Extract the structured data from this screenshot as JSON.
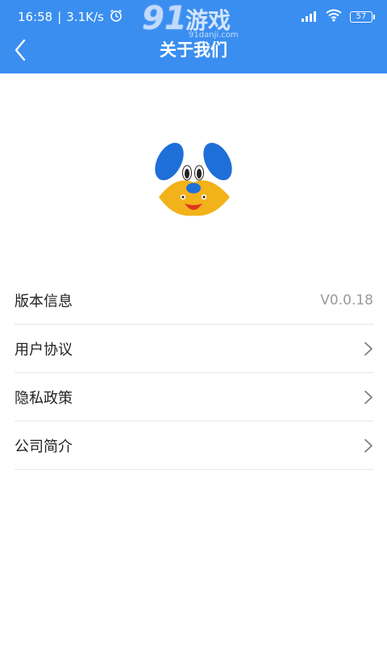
{
  "status_bar": {
    "time": "16:58",
    "speed": "3.1K/s",
    "battery": "57",
    "icons": [
      "alarm-icon",
      "signal-icon",
      "wifi-icon",
      "battery-icon"
    ]
  },
  "watermark": {
    "number": "91",
    "text": "游戏",
    "url": "91danji.com"
  },
  "header": {
    "title": "关于我们",
    "back_icon": "chevron-left-icon"
  },
  "menu": [
    {
      "label": "版本信息",
      "value": "V0.0.18"
    },
    {
      "label": "用户协议",
      "icon": "chevron-right-icon"
    },
    {
      "label": "隐私政策",
      "icon": "chevron-right-icon"
    },
    {
      "label": "公司简介",
      "icon": "chevron-right-icon"
    }
  ],
  "colors": {
    "header_bg": "#3a8ef0",
    "ear_blue": "#1f6fd8",
    "face_yellow": "#f2b21a",
    "divider": "#e7e7e7"
  }
}
